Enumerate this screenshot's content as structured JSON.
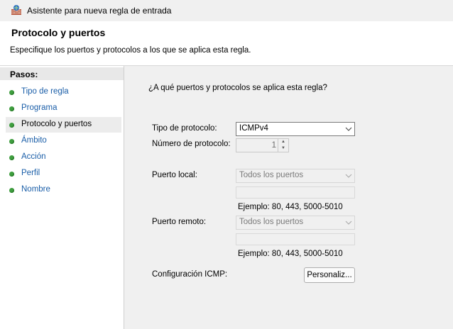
{
  "window": {
    "title": "Asistente para nueva regla de entrada",
    "icon": "firewall-wizard-icon"
  },
  "header": {
    "title": "Protocolo y puertos",
    "description": "Especifique los puertos y protocolos a los que se aplica esta regla."
  },
  "sidebar": {
    "heading": "Pasos:",
    "items": [
      {
        "label": "Tipo de regla"
      },
      {
        "label": "Programa"
      },
      {
        "label": "Protocolo y puertos",
        "selected": true
      },
      {
        "label": "Ámbito"
      },
      {
        "label": "Acción"
      },
      {
        "label": "Perfil"
      },
      {
        "label": "Nombre"
      }
    ],
    "bullet_color": "#3f9f3f"
  },
  "main": {
    "question": "¿A qué puertos y protocolos se aplica esta regla?",
    "protocol_type": {
      "label": "Tipo de protocolo:",
      "value": "ICMPv4"
    },
    "protocol_number": {
      "label": "Número de protocolo:",
      "value": "1"
    },
    "local_port": {
      "label": "Puerto local:",
      "value": "Todos los puertos",
      "example": "Ejemplo: 80, 443, 5000-5010"
    },
    "remote_port": {
      "label": "Puerto remoto:",
      "value": "Todos los puertos",
      "example": "Ejemplo: 80, 443, 5000-5010"
    },
    "icmp": {
      "label": "Configuración ICMP:",
      "button": "Personaliz..."
    }
  }
}
